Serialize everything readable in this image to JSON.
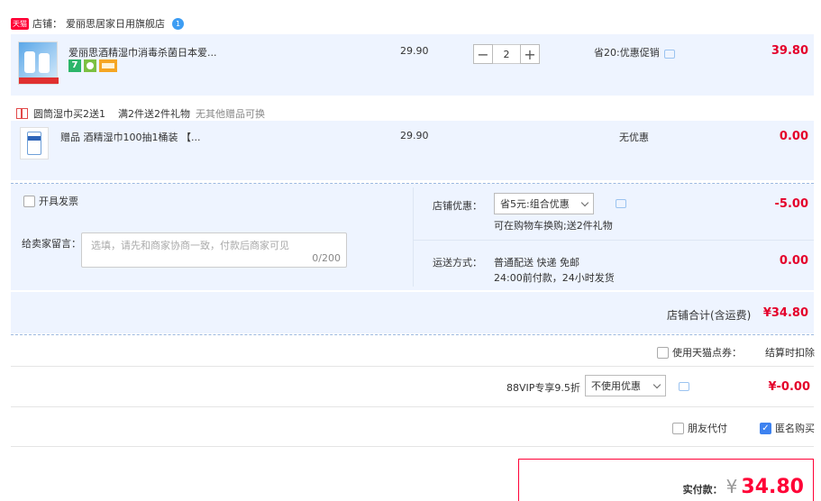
{
  "shop": {
    "tag": "天猫",
    "label": "店铺：",
    "name": "爱丽思居家日用旗舰店",
    "badge": "1"
  },
  "item1": {
    "title": "爱丽思酒精湿巾消毒杀菌日本爱...",
    "badge1": "7",
    "unit_price": "29.90",
    "qty": "2",
    "minus": "−",
    "plus": "+",
    "promo": "省20:优惠促销",
    "total": "39.80"
  },
  "gift": {
    "label": "圆筒湿巾买2送1",
    "rule": "满2件送2件礼物",
    "note": "无其他赠品可换",
    "title": "赠品 酒精湿巾100抽1桶装 【...",
    "price": "29.90",
    "promo": "无优惠",
    "total": "0.00"
  },
  "invoice": {
    "label": "开具发票"
  },
  "message": {
    "label": "给卖家留言：",
    "placeholder": "选填，请先和商家协商一致，付款后商家可见",
    "counter": "0/200"
  },
  "shop_discount": {
    "label": "店铺优惠：",
    "selected": "省5元:组合优惠",
    "note": "可在购物车换购;送2件礼物",
    "value": "-5.00"
  },
  "shipping": {
    "label": "运送方式：",
    "method": "普通配送 快递 免邮",
    "timing": "24:00前付款，24小时发货",
    "value": "0.00"
  },
  "shop_total": {
    "label": "店铺合计(含运费)",
    "value": "¥34.80"
  },
  "points": {
    "label": "使用天猫点券：",
    "note": "结算时扣除"
  },
  "vip": {
    "label": "88VIP专享9.5折",
    "selected": "不使用优惠",
    "value": "¥-0.00"
  },
  "options": {
    "friend_pay": "朋友代付",
    "anonymous": "匿名购买"
  },
  "pay": {
    "label": "实付款：",
    "currency": "¥",
    "value": "34.80"
  },
  "colors": {
    "accent_red": "#ff0036",
    "price_red": "#e4002b",
    "light_blue_bg": "#eef4ff",
    "checkbox_blue": "#3d82f0"
  }
}
